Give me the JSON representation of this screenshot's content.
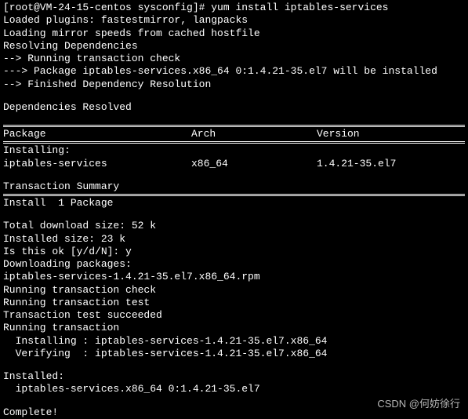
{
  "prompt": "[root@VM-24-15-centos sysconfig]# yum install iptables-services",
  "lines_top": [
    "Loaded plugins: fastestmirror, langpacks",
    "Loading mirror speeds from cached hostfile",
    "Resolving Dependencies",
    "--> Running transaction check",
    "---> Package iptables-services.x86_64 0:1.4.21-35.el7 will be installed",
    "--> Finished Dependency Resolution"
  ],
  "deps_resolved": "Dependencies Resolved",
  "table": {
    "headers": {
      "pkg": " Package",
      "arch": "Arch",
      "ver": "Version"
    },
    "installing_label": "Installing:",
    "row": {
      "pkg": " iptables-services",
      "arch": "x86_64",
      "ver": "1.4.21-35.el7"
    }
  },
  "txn_summary": "Transaction Summary",
  "install_count": "Install  1 Package",
  "lines_mid": [
    "Total download size: 52 k",
    "Installed size: 23 k"
  ],
  "confirm_prompt": "Is this ok [y/d/N]: y",
  "lines_dl": [
    "Downloading packages:",
    "iptables-services-1.4.21-35.el7.x86_64.rpm",
    "Running transaction check",
    "Running transaction test",
    "Transaction test succeeded",
    "Running transaction",
    "  Installing : iptables-services-1.4.21-35.el7.x86_64",
    "  Verifying  : iptables-services-1.4.21-35.el7.x86_64"
  ],
  "installed_label": "Installed:",
  "installed_pkg": "  iptables-services.x86_64 0:1.4.21-35.el7",
  "complete": "Complete!",
  "watermark": "CSDN @何妨徐行"
}
